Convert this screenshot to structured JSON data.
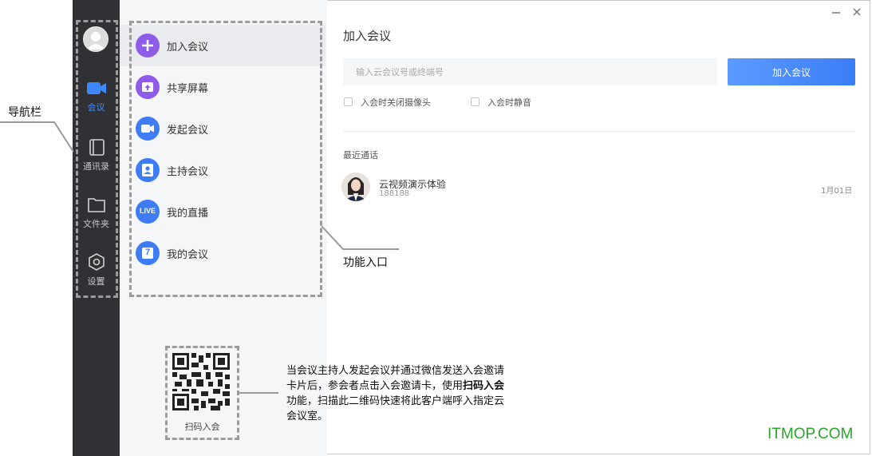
{
  "annotations": {
    "nav_label": "导航栏",
    "func_label": "功能入口",
    "qr_desc_part1": "当会议主持人发起会议并通过微信发送入会邀请卡片后，参会者点击入会邀请卡，使用",
    "qr_desc_bold": "扫码入会",
    "qr_desc_part2": "功能，扫描此二维码快速将此客户端呼入指定云会议室。",
    "qr_caption": "扫码入会"
  },
  "nav": {
    "items": [
      {
        "label": "会议",
        "icon": "video-camera-icon",
        "active": true
      },
      {
        "label": "通讯录",
        "icon": "contacts-book-icon",
        "active": false
      },
      {
        "label": "文件夹",
        "icon": "folder-icon",
        "active": false
      },
      {
        "label": "设置",
        "icon": "hexagon-settings-icon",
        "active": false
      }
    ],
    "active_color": "#4a8cff"
  },
  "functions": {
    "items": [
      {
        "label": "加入会议",
        "icon": "plus-icon",
        "color": "#8f5ce8"
      },
      {
        "label": "共享屏幕",
        "icon": "share-screen-icon",
        "color": "#8f5ce8"
      },
      {
        "label": "发起会议",
        "icon": "video-camera-icon",
        "color": "#3d7cf5"
      },
      {
        "label": "主持会议",
        "icon": "host-user-icon",
        "color": "#3d7cf5"
      },
      {
        "label": "我的直播",
        "icon": "live-icon",
        "color": "#3d7cf5",
        "badge": "LIVE"
      },
      {
        "label": "我的会议",
        "icon": "calendar-icon",
        "color": "#3d7cf5",
        "badge": "7"
      }
    ]
  },
  "main": {
    "title": "加入会议",
    "input_placeholder": "输入云会议号或终端号",
    "join_button": "加入会议",
    "option_camera_off": "入会时关闭摄像头",
    "option_mute": "入会时静音",
    "recent_title": "最近通话",
    "recent": {
      "name": "云视频演示体验",
      "id": "188188",
      "date": "1月01日"
    }
  },
  "watermark": "ITMOP.COM"
}
